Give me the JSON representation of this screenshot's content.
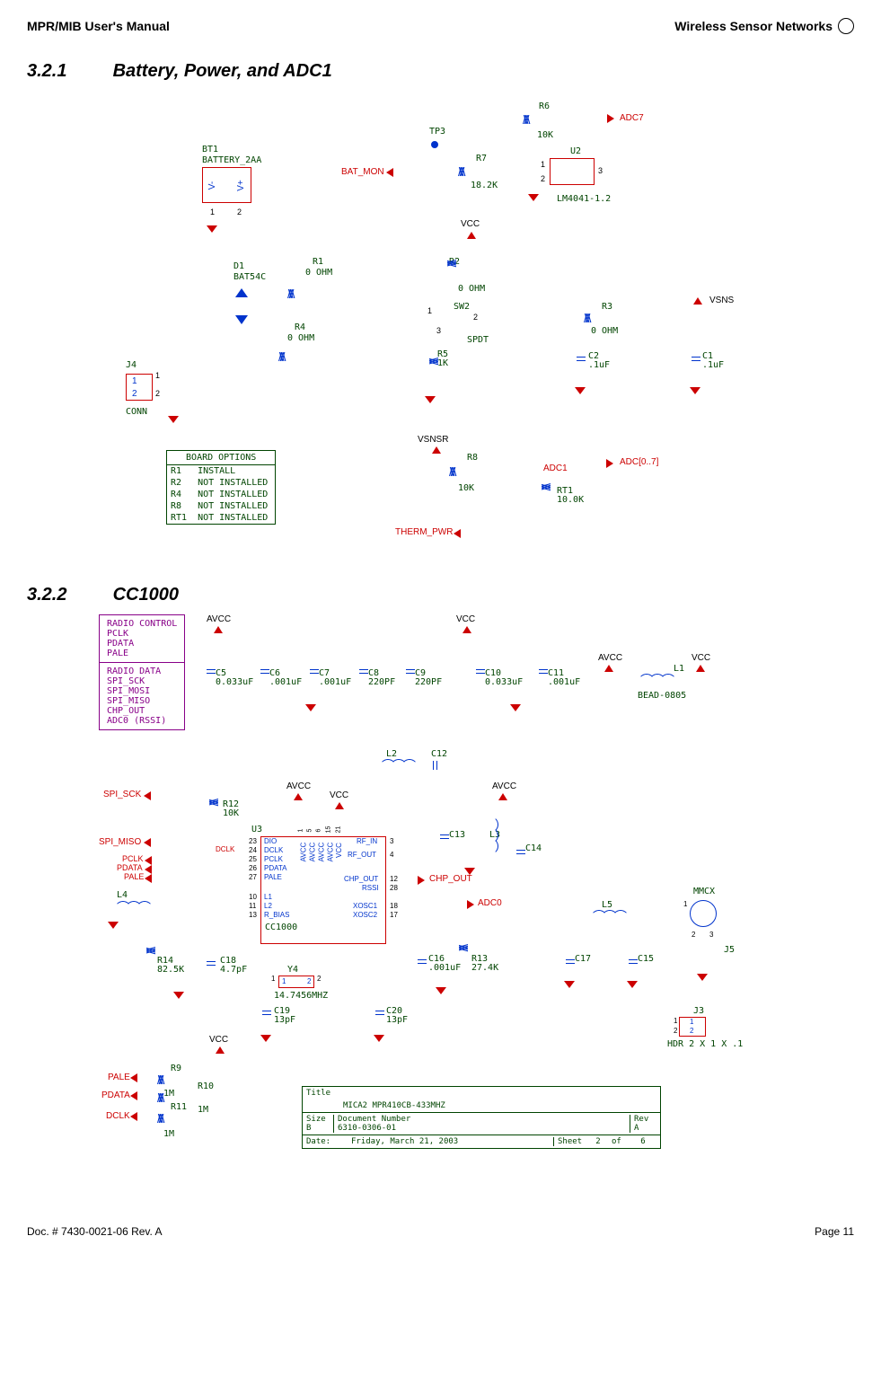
{
  "header": {
    "left": "MPR/MIB User's Manual",
    "right": "Wireless Sensor Networks"
  },
  "section1": {
    "num": "3.2.1",
    "title": "Battery, Power, and ADC1"
  },
  "section2": {
    "num": "3.2.2",
    "title": "CC1000"
  },
  "battery": {
    "conn_label_j4": "J4",
    "conn_type": "CONN",
    "conn_pin1": "1",
    "conn_pin2": "2",
    "bt1": "BT1",
    "battery_part": "BATTERY_2AA",
    "vminus": "V-",
    "vplus": "V+",
    "d1": "D1",
    "d1_part": "BAT54C",
    "r1": "R1",
    "r1_val": "0 OHM",
    "r4": "R4",
    "r4_val": "0 OHM",
    "r2": "R2",
    "r2_val": "0 OHM",
    "r3": "R3",
    "r3_val": "0 OHM",
    "r5": "R5",
    "r5_val": "1K",
    "r6": "R6",
    "r6_val": "10K",
    "r7": "R7",
    "r7_val": "18.2K",
    "r8": "R8",
    "r8_val": "10K",
    "sw2": "SW2",
    "sw2_type": "SPDT",
    "sw_pin1": "1",
    "sw_pin2": "2",
    "sw_pin3": "3",
    "c1": "C1",
    "c1_val": ".1uF",
    "c2": "C2",
    "c2_val": ".1uF",
    "u2": "U2",
    "u2_part": "LM4041-1.2",
    "u2_pin1": "1",
    "u2_pin2": "2",
    "u2_pin3": "3",
    "tp3": "TP3",
    "rt1": "RT1",
    "rt1_val": "10.0K",
    "net_vcc": "VCC",
    "net_vsns": "VSNS",
    "net_vsnsr": "VSNSR",
    "net_adc1": "ADC1",
    "net_adc7": "ADC7",
    "net_adc_bus": "ADC[0..7]",
    "net_batmon": "BAT_MON",
    "net_thermpwr": "THERM_PWR"
  },
  "board_options": {
    "title": "BOARD OPTIONS",
    "rows": [
      {
        "part": "R1",
        "note": "INSTALL"
      },
      {
        "part": "R2",
        "note": "NOT INSTALLED"
      },
      {
        "part": "R4",
        "note": "NOT INSTALLED"
      },
      {
        "part": "R8",
        "note": "NOT INSTALLED"
      },
      {
        "part": "RT1",
        "note": "NOT INSTALLED"
      }
    ]
  },
  "cc1000": {
    "radio_control_title": "RADIO CONTROL",
    "radio_control_items": [
      "PCLK",
      "PDATA",
      "PALE"
    ],
    "radio_data_title": "RADIO DATA",
    "radio_data_items": [
      "SPI_SCK",
      "SPI_MOSI",
      "SPI_MISO",
      "CHP_OUT",
      "ADC0 (RSSI)"
    ],
    "net_avcc": "AVCC",
    "net_vcc": "VCC",
    "caps": [
      {
        "ref": "C5",
        "val": "0.033uF"
      },
      {
        "ref": "C6",
        "val": ".001uF"
      },
      {
        "ref": "C7",
        "val": ".001uF"
      },
      {
        "ref": "C8",
        "val": "220PF"
      },
      {
        "ref": "C9",
        "val": "220PF"
      },
      {
        "ref": "C10",
        "val": "0.033uF"
      },
      {
        "ref": "C11",
        "val": ".001uF"
      }
    ],
    "l1": "L1",
    "l1_part": "BEAD-0805",
    "u3": "U3",
    "u3_part": "CC1000",
    "u3_pins_left": [
      {
        "n": "23",
        "name": "DIO"
      },
      {
        "n": "24",
        "name": "DCLK"
      },
      {
        "n": "25",
        "name": "PCLK"
      },
      {
        "n": "26",
        "name": "PDATA"
      },
      {
        "n": "27",
        "name": "PALE"
      },
      {
        "n": "10",
        "name": "L1"
      },
      {
        "n": "11",
        "name": "L2"
      },
      {
        "n": "13",
        "name": "R_BIAS"
      }
    ],
    "u3_pins_top": [
      "AVCC",
      "AVCC",
      "AVCC",
      "AVCC",
      "VCC"
    ],
    "u3_pins_top_nums": [
      "1",
      "5",
      "6",
      "15",
      "21"
    ],
    "u3_pins_right": [
      {
        "n": "3",
        "name": "RF_IN"
      },
      {
        "n": "4",
        "name": "RF_OUT"
      },
      {
        "n": "12",
        "name": "CHP_OUT"
      },
      {
        "n": "28",
        "name": "RSSI"
      },
      {
        "n": "18",
        "name": "XOSC1"
      },
      {
        "n": "17",
        "name": "XOSC2"
      }
    ],
    "sig_spi_sck": "SPI_SCK",
    "sig_spi_miso": "SPI_MISO",
    "sig_dclk": "DCLK",
    "sig_pclk": "PCLK",
    "sig_pdata": "PDATA",
    "sig_pale": "PALE",
    "sig_chp_out": "CHP_OUT",
    "sig_adc0": "ADC0",
    "r12": "R12",
    "r12_val": "10K",
    "r13": "R13",
    "r13_val": "27.4K",
    "r14": "R14",
    "r14_val": "82.5K",
    "c12": "C12",
    "c13": "C13",
    "c14": "C14",
    "c15": "C15",
    "c16": "C16",
    "c16_val": ".001uF",
    "c17": "C17",
    "c18": "C18",
    "c18_val": "4.7pF",
    "c19": "C19",
    "c19_val": "13pF",
    "c20": "C20",
    "c20_val": "13pF",
    "l2": "L2",
    "l3": "L3",
    "l4": "L4",
    "l5": "L5",
    "y4": "Y4",
    "y4_val": "14.7456MHZ",
    "y4_pin1": "1",
    "y4_pin2": "2",
    "r9": "R9",
    "r9_val": "1M",
    "r10": "R10",
    "r10_val": "1M",
    "r11": "R11",
    "r11_val": "1M",
    "mmcx": "MMCX",
    "mmcx_pin1": "1",
    "mmcx_pin2": "2",
    "mmcx_pin3": "3",
    "j5": "J5",
    "j3": "J3",
    "j3_part": "HDR 2 X 1 X .1",
    "j3_pin1": "1",
    "j3_pin2": "2"
  },
  "titleblock": {
    "title_label": "Title",
    "title": "MICA2 MPR410CB-433MHZ",
    "size_label": "Size",
    "size": "B",
    "docnum_label": "Document Number",
    "docnum": "6310-0306-01",
    "rev_label": "Rev",
    "rev": "A",
    "date_label": "Date:",
    "date": "Friday, March 21, 2003",
    "sheet_label": "Sheet",
    "sheet_cur": "2",
    "sheet_of": "of",
    "sheet_tot": "6"
  },
  "footer": {
    "left": "Doc. # 7430-0021-06 Rev. A",
    "right": "Page 11"
  }
}
